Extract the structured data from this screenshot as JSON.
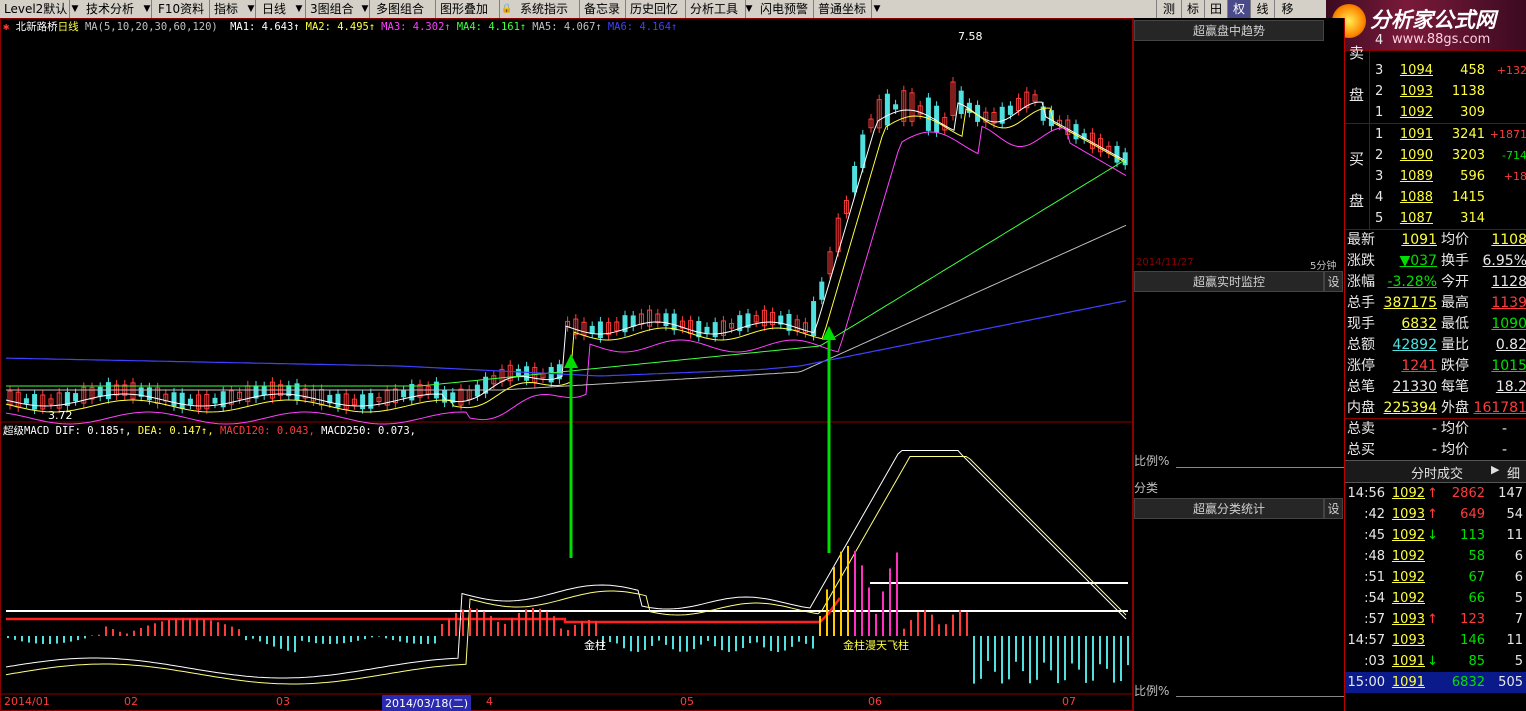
{
  "menu": {
    "items": [
      "Level2默认",
      "技术分析",
      "F10资料",
      "指标",
      "日线",
      "3图组合",
      "多图组合",
      "图形叠加",
      "系统指示",
      "备忘录",
      "历史回忆",
      "分析工具",
      "闪电预警",
      "普通坐标"
    ],
    "right_tools": [
      "测",
      "标",
      "田",
      "权",
      "线",
      "移"
    ]
  },
  "logo": {
    "title": "分析家公式网",
    "url": "www.88gs.com"
  },
  "chart": {
    "stock_name": "北新路桥",
    "period": "日线",
    "ma_legend": "MA(5,10,20,30,60,120)",
    "ma": [
      {
        "label": "MA1: 4.643↑",
        "color": "#ffffff"
      },
      {
        "label": "MA2: 4.495↑",
        "color": "#ffff40"
      },
      {
        "label": "MA3: 4.302↑",
        "color": "#ff40ff"
      },
      {
        "label": "MA4: 4.161↑",
        "color": "#40ff40"
      },
      {
        "label": "MA5: 4.067↑",
        "color": "#c0c0c0"
      },
      {
        "label": "MA6: 4.164↑",
        "color": "#4040ff"
      }
    ],
    "high_label": "7.58",
    "low_label": "3.72",
    "macd_legend": {
      "name": "超级MACD",
      "dif": "DIF: 0.185↑,",
      "dea": "DEA: 0.147↑,",
      "macd120": "MACD120: 0.043,",
      "macd250": "MACD250: 0.073,"
    },
    "annotations": [
      "金柱",
      "金柱漫天飞柱"
    ],
    "date_labels": [
      "2014/01",
      "02",
      "03",
      "2014/03/18(二)",
      "4",
      "05",
      "06",
      "07"
    ],
    "colors": {
      "up": "#ff3c3c",
      "down": "#4fe0e0",
      "grid": "#8b0000",
      "arrow": "#00dd00"
    }
  },
  "middle": {
    "panel1": "超赢盘中趋势",
    "date": "2014/11/27",
    "interval": "5分钟",
    "panel2": "超赢实时监控",
    "set": "设",
    "ratio": "比例%",
    "category": "分类",
    "panel3": "超赢分类统计",
    "ratio2": "比例%"
  },
  "orderbook": {
    "sell_label_chars": [
      "卖",
      "盘"
    ],
    "buy_label_chars": [
      "买",
      "盘"
    ],
    "sell": [
      {
        "level": "4",
        "price": "",
        "vol": "",
        "chg": ""
      },
      {
        "level": "3",
        "price": "1094",
        "vol": "458",
        "chg": "+132"
      },
      {
        "level": "2",
        "price": "1093",
        "vol": "1138",
        "chg": ""
      },
      {
        "level": "1",
        "price": "1092",
        "vol": "309",
        "chg": ""
      }
    ],
    "buy": [
      {
        "level": "1",
        "price": "1091",
        "vol": "3241",
        "chg": "+1871"
      },
      {
        "level": "2",
        "price": "1090",
        "vol": "3203",
        "chg": "-714"
      },
      {
        "level": "3",
        "price": "1089",
        "vol": "596",
        "chg": "+18"
      },
      {
        "level": "4",
        "price": "1088",
        "vol": "1415",
        "chg": ""
      },
      {
        "level": "5",
        "price": "1087",
        "vol": "314",
        "chg": ""
      }
    ]
  },
  "quote": [
    {
      "l1": "最新",
      "v1": "1091",
      "l2": "均价",
      "v2": "1108"
    },
    {
      "l1": "涨跌",
      "v1": "▼037",
      "l2": "换手",
      "v2": "6.95%"
    },
    {
      "l1": "涨幅",
      "v1": "-3.28%",
      "l2": "今开",
      "v2": "1128"
    },
    {
      "l1": "总手",
      "v1": "387175",
      "l2": "最高",
      "v2": "1139"
    },
    {
      "l1": "现手",
      "v1": "6832",
      "l2": "最低",
      "v2": "1090"
    },
    {
      "l1": "总额",
      "v1": "42892",
      "l2": "量比",
      "v2": "0.82"
    },
    {
      "l1": "涨停",
      "v1": "1241",
      "l2": "跌停",
      "v2": "1015"
    },
    {
      "l1": "总笔",
      "v1": "21330",
      "l2": "每笔",
      "v2": "18.2"
    },
    {
      "l1": "内盘",
      "v1": "225394",
      "l2": "外盘",
      "v2": "161781"
    }
  ],
  "totals": [
    {
      "l1": "总卖",
      "v1": "-",
      "l2": "均价",
      "v2": "-"
    },
    {
      "l1": "总买",
      "v1": "-",
      "l2": "均价",
      "v2": "-"
    }
  ],
  "ticks_header": "分时成交",
  "ticks_detail": "细",
  "ticks": [
    {
      "time": "14:56",
      "price": "1092",
      "arrow": "↑",
      "vol": "2862",
      "n": "147"
    },
    {
      "time": ":42",
      "price": "1093",
      "arrow": "↑",
      "vol": "649",
      "n": "54"
    },
    {
      "time": ":45",
      "price": "1092",
      "arrow": "↓",
      "vol": "113",
      "n": "11"
    },
    {
      "time": ":48",
      "price": "1092",
      "arrow": "",
      "vol": "58",
      "n": "6"
    },
    {
      "time": ":51",
      "price": "1092",
      "arrow": "",
      "vol": "67",
      "n": "6"
    },
    {
      "time": ":54",
      "price": "1092",
      "arrow": "",
      "vol": "66",
      "n": "5"
    },
    {
      "time": ":57",
      "price": "1093",
      "arrow": "↑",
      "vol": "123",
      "n": "7"
    },
    {
      "time": "14:57",
      "price": "1093",
      "arrow": "",
      "vol": "146",
      "n": "11"
    },
    {
      "time": ":03",
      "price": "1091",
      "arrow": "↓",
      "vol": "85",
      "n": "5"
    },
    {
      "time": "15:00",
      "price": "1091",
      "arrow": "",
      "vol": "6832",
      "n": "505"
    }
  ]
}
